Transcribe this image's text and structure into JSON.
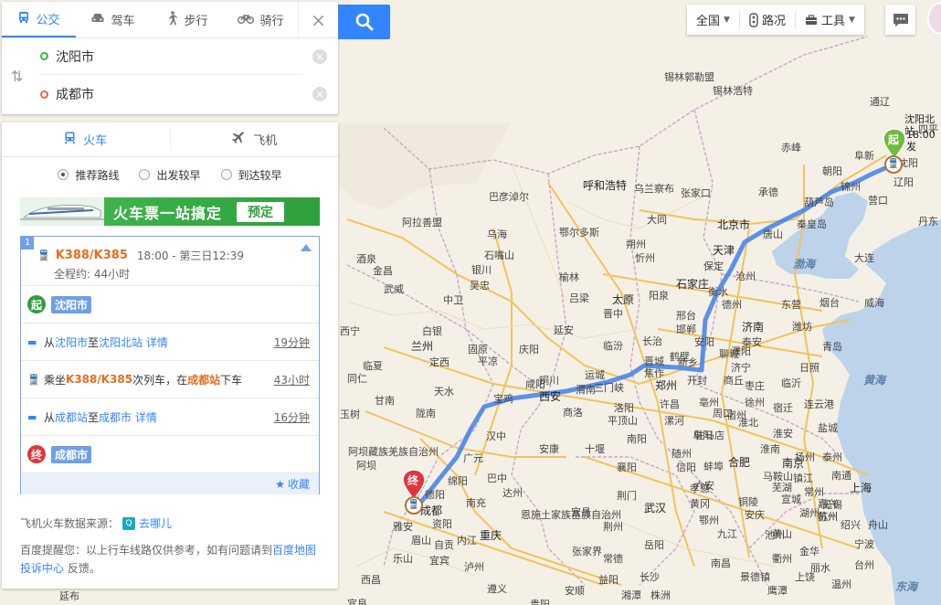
{
  "modes": [
    {
      "label": "公交",
      "icon": "bus-icon",
      "active": true
    },
    {
      "label": "驾车",
      "icon": "car-icon",
      "active": false
    },
    {
      "label": "步行",
      "icon": "walk-icon",
      "active": false
    },
    {
      "label": "骑行",
      "icon": "bike-icon",
      "active": false
    }
  ],
  "search": {
    "start": "沈阳市",
    "end": "成都市"
  },
  "result_tabs": {
    "train": "火车",
    "plane": "飞机"
  },
  "sort_options": {
    "recommended": "推荐路线",
    "depart_early": "出发较早",
    "arrive_early": "到达较早"
  },
  "banner": {
    "text": "火车票一站搞定",
    "button": "预定"
  },
  "route": {
    "index": "1",
    "train_no": "K388/K385",
    "time": "18:00 - 第三日12:39",
    "total": "全程约: 44小时",
    "start_badge": "起",
    "start_place": "沈阳市",
    "end_badge": "终",
    "end_place": "成都市",
    "steps": [
      {
        "pre": "从 ",
        "a": "沈阳市",
        "mid": " 至 ",
        "b": "沈阳北站",
        "detail": "详情",
        "dur": "19分钟"
      },
      {
        "pre": "乘坐 ",
        "train": "K388/K385",
        "mid": " 次列车，在 ",
        "station": "成都站",
        "post": " 下车",
        "dur": "43小时"
      },
      {
        "pre": "从 ",
        "a": "成都站",
        "mid": " 至 ",
        "b": "成都市",
        "detail": "详情",
        "dur": "16分钟"
      }
    ],
    "favorite": "收藏"
  },
  "source": {
    "label": "飞机火车数据来源：",
    "provider": "去哪儿"
  },
  "notice": {
    "text": "百度提醒您：以上行车线路仅供参考，如有问题请到",
    "link": "百度地图投诉中心",
    "suffix": " 反馈。"
  },
  "toolbar": {
    "region": "全国",
    "traffic": "路况",
    "tools": "工具"
  },
  "map": {
    "start_marker": "起",
    "end_marker": "终",
    "start_label_1": "沈阳北站",
    "start_label_2": "18:00发",
    "seas": [
      "渤海",
      "黄海",
      "东海"
    ],
    "cities": [
      "锡林郭勒盟",
      "锡林浩特",
      "巴彦淖尔",
      "呼和浩特",
      "乌兰察布",
      "张家口",
      "北京市",
      "天津",
      "唐山",
      "秦皇岛",
      "承德",
      "朝阳",
      "阜新",
      "锦州",
      "葫芦岛",
      "沈阳",
      "辽阳",
      "营口",
      "丹东",
      "大连",
      "通辽",
      "四平",
      "赤峰",
      "鄂尔多斯",
      "大同",
      "忻州",
      "朔州",
      "石家庄",
      "保定",
      "沧州",
      "衡水",
      "德州",
      "济南",
      "东营",
      "潍坊",
      "烟台",
      "威海",
      "青岛",
      "日照",
      "泰安",
      "济宁",
      "枣庄",
      "临沂",
      "徐州",
      "邢台",
      "邯郸",
      "聊城",
      "太原",
      "吕梁",
      "晋中",
      "阳泉",
      "长治",
      "晋城",
      "临汾",
      "运城",
      "三门峡",
      "洛阳",
      "郑州",
      "开封",
      "商丘",
      "新乡",
      "焦作",
      "鹤壁",
      "安阳",
      "濮阳",
      "许昌",
      "漯河",
      "周口",
      "平顶山",
      "驻马店",
      "信阳",
      "南阳",
      "阿拉善盟",
      "乌海",
      "石嘴山",
      "银川",
      "吴忠",
      "中卫",
      "固原",
      "平凉",
      "庆阳",
      "延安",
      "榆林",
      "天水",
      "宝鸡",
      "咸阳",
      "西安",
      "铜川",
      "渭南",
      "商洛",
      "汉中",
      "安康",
      "十堰",
      "襄阳",
      "随州",
      "荆门",
      "孝感",
      "武汉",
      "黄冈",
      "鄂州",
      "荆州",
      "宜昌",
      "恩施土家族苗族自治州",
      "巴中",
      "广元",
      "南充",
      "达州",
      "德阳",
      "绵阳",
      "成都",
      "资阳",
      "雅安",
      "眉山",
      "内江",
      "自贡",
      "宜宾",
      "泸州",
      "乐山",
      "重庆",
      "遵义",
      "贵阳",
      "张家界",
      "常德",
      "岳阳",
      "长沙",
      "益阳",
      "株洲",
      "湘潭",
      "南昌",
      "九江",
      "景德镇",
      "鹰潭",
      "上饶",
      "合肥",
      "六安",
      "淮南",
      "蚌埠",
      "阜阳",
      "亳州",
      "宿州",
      "淮北",
      "宿迁",
      "淮安",
      "连云港",
      "盐城",
      "扬州",
      "泰州",
      "南通",
      "镇江",
      "常州",
      "无锡",
      "苏州",
      "南京",
      "马鞍山",
      "芜湖",
      "铜陵",
      "安庆",
      "池州",
      "宣城",
      "湖州",
      "嘉兴",
      "上海",
      "杭州",
      "绍兴",
      "宁波",
      "舟山",
      "金华",
      "衢州",
      "丽水",
      "台州",
      "温州",
      "黄山",
      "金昌",
      "武威",
      "白银",
      "兰州",
      "定西",
      "陇南",
      "临夏",
      "甘南",
      "西宁",
      "同仁",
      "阿坝藏族羌族自治州",
      "西昌",
      "延布",
      "玉树",
      "酒泉",
      "阿坝",
      "宜良",
      "安顺"
    ]
  },
  "colors": {
    "accent": "#3385ff",
    "route_line": "#4a86e8",
    "start_green": "#2ea03c",
    "end_red": "#e2353b",
    "train_orange": "#e66d1f"
  }
}
